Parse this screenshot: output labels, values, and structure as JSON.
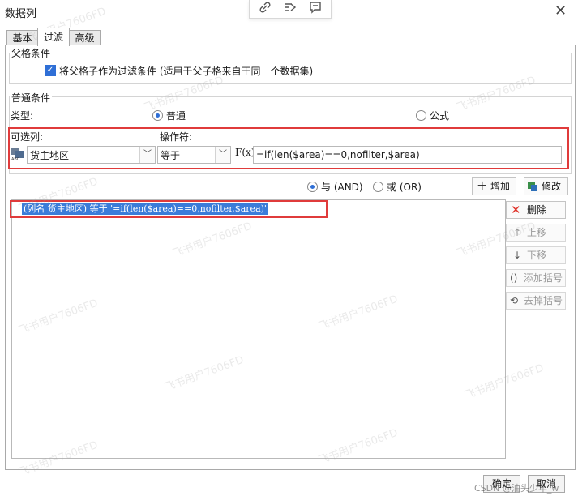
{
  "window": {
    "title": "数据列",
    "close": "✕"
  },
  "toolbar_icons": [
    "link-icon",
    "share-icon",
    "comment-icon"
  ],
  "tabs": [
    {
      "label": "基本"
    },
    {
      "label": "过滤"
    },
    {
      "label": "高级"
    }
  ],
  "parent_condition": {
    "group_label": "父格条件",
    "checkbox_label": "将父格子作为过滤条件 (适用于父子格来自于同一个数据集)",
    "checked": true
  },
  "normal_condition": {
    "group_label": "普通条件",
    "type_label": "类型:",
    "type_normal": "普通",
    "type_formula": "公式",
    "selected_type": "普通",
    "column_label": "可选列:",
    "operator_label": "操作符:",
    "column_value": "货主地区",
    "operator_value": "等于",
    "fx_label": "F(x)",
    "formula_value": "=if(len($area)==0,nofilter,$area)"
  },
  "logic": {
    "and_label": "与 (AND)",
    "or_label": "或 (OR)",
    "selected": "and"
  },
  "actions": {
    "add": "增加",
    "modify": "修改",
    "delete": "删除",
    "move_up": "上移",
    "move_down": "下移",
    "add_bracket": "添加括号",
    "remove_bracket": "去掉括号"
  },
  "conditions": [
    {
      "text": "(列名 货主地区) 等于 '=if(len($area)==0,nofilter,$area)'"
    }
  ],
  "footer": {
    "ok": "确定",
    "cancel": "取消",
    "credit": "CSDN @油头少年_w"
  },
  "watermark": "飞书用户7606FD",
  "colors": {
    "accent": "#2f6fd6",
    "highlight_box": "#e03b3b",
    "selection": "#3b7cd9",
    "delete_red": "#e0342b"
  }
}
